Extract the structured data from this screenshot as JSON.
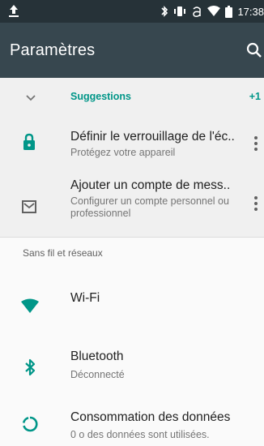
{
  "status_bar": {
    "time": "17:38",
    "icons": [
      "upload-icon",
      "bluetooth-icon",
      "vibrate-icon",
      "a-icon",
      "wifi-icon",
      "battery-icon"
    ]
  },
  "app_bar": {
    "title": "Paramètres",
    "search_icon": "search-icon"
  },
  "suggestions": {
    "header_label": "Suggestions",
    "count": "+1",
    "items": [
      {
        "title": "Définir le verrouillage de l'éc..",
        "subtitle": "Protégez votre appareil",
        "icon": "lock-icon"
      },
      {
        "title": "Ajouter un compte de mess..",
        "subtitle": "Configurer un compte personnel ou professionnel",
        "icon": "mail-icon"
      }
    ]
  },
  "category": {
    "label": "Sans fil et réseaux"
  },
  "settings": [
    {
      "title": "Wi-Fi",
      "subtitle": "",
      "icon": "wifi-icon"
    },
    {
      "title": "Bluetooth",
      "subtitle": "Déconnecté",
      "icon": "bluetooth-icon"
    },
    {
      "title": "Consommation des données",
      "subtitle": "0 o des données sont utilisées.",
      "icon": "data-usage-icon"
    }
  ],
  "colors": {
    "accent": "#009688",
    "status_bar": "#263238",
    "app_bar": "#37474f",
    "suggestion_bg": "#f0f0f0",
    "background": "#fafafa"
  }
}
